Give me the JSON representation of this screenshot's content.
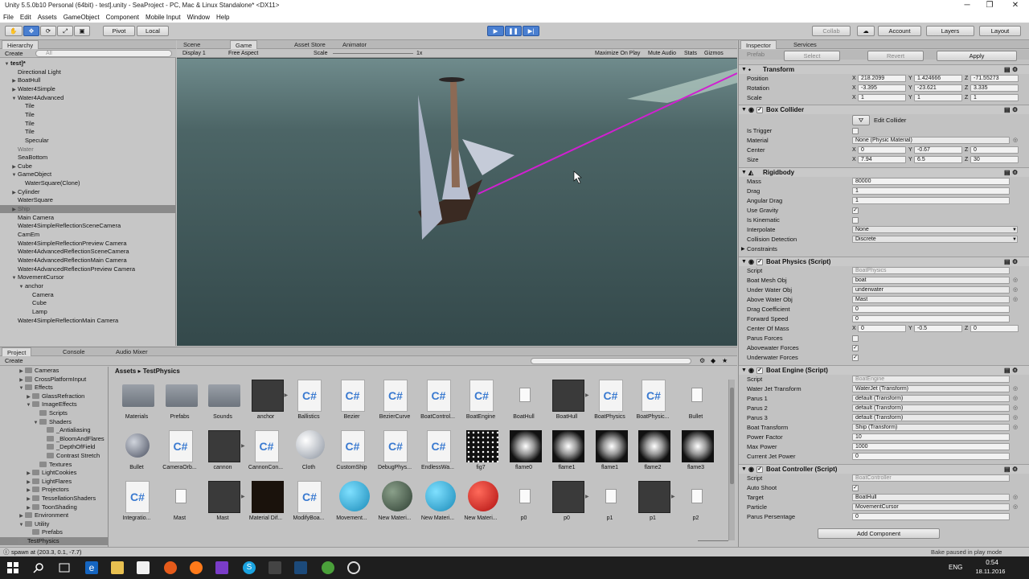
{
  "window": {
    "title": "Unity 5.5.0b10 Personal (64bit) - test].unity - SeaProject - PC, Mac & Linux Standalone* <DX11>",
    "minimize": "─",
    "maximize": "❐",
    "close": "✕"
  },
  "menu": [
    "File",
    "Edit",
    "Assets",
    "GameObject",
    "Component",
    "Mobile Input",
    "Window",
    "Help"
  ],
  "toolbar": {
    "pivot": "Pivot",
    "local": "Local",
    "collab": "Collab",
    "account": "Account",
    "layers": "Layers",
    "layout": "Layout"
  },
  "hierarchy": {
    "tab": "Hierarchy",
    "create": "Create",
    "search_placeholder": "All",
    "items": [
      {
        "label": "test]*",
        "tri": "▼",
        "bold": true
      },
      {
        "label": "Directional Light",
        "tri": ""
      },
      {
        "label": "BoatHull",
        "tri": "▶"
      },
      {
        "label": "Water4Simple",
        "tri": "▶"
      },
      {
        "label": "Water4Advanced",
        "tri": "▼"
      },
      {
        "label": "Tile",
        "tri": ""
      },
      {
        "label": "Tile",
        "tri": ""
      },
      {
        "label": "Tile",
        "tri": ""
      },
      {
        "label": "Tile",
        "tri": ""
      },
      {
        "label": "Specular",
        "tri": ""
      },
      {
        "label": "Water",
        "tri": "",
        "dim": true
      },
      {
        "label": "SeaBottom",
        "tri": ""
      },
      {
        "label": "Cube",
        "tri": "▶"
      },
      {
        "label": "GameObject",
        "tri": "▼"
      },
      {
        "label": "WaterSquare(Clone)",
        "tri": ""
      },
      {
        "label": "Cylinder",
        "tri": "▶"
      },
      {
        "label": "WaterSquare",
        "tri": ""
      },
      {
        "label": "Ship",
        "tri": "▶",
        "sel": true
      },
      {
        "label": "Main Camera",
        "tri": ""
      },
      {
        "label": "Water4SimpleReflectionSceneCamera",
        "tri": ""
      },
      {
        "label": "CamEm",
        "tri": ""
      },
      {
        "label": "Water4SimpleReflectionPreview Camera",
        "tri": ""
      },
      {
        "label": "Water4AdvancedReflectionSceneCamera",
        "tri": ""
      },
      {
        "label": "Water4AdvancedReflectionMain Camera",
        "tri": ""
      },
      {
        "label": "Water4AdvancedReflectionPreview Camera",
        "tri": ""
      },
      {
        "label": "MovementCursor",
        "tri": "▼"
      },
      {
        "label": "anchor",
        "tri": "▼"
      },
      {
        "label": "Camera",
        "tri": ""
      },
      {
        "label": "Cube",
        "tri": ""
      },
      {
        "label": "Lamp",
        "tri": ""
      },
      {
        "label": "Water4SimpleReflectionMain Camera",
        "tri": ""
      }
    ]
  },
  "view_tabs": {
    "scene": "Scene",
    "game": "Game",
    "asset_store": "Asset Store",
    "animator": "Animator"
  },
  "game_bar": {
    "display": "Display 1",
    "aspect": "Free Aspect",
    "scale_label": "Scale",
    "scale_value": "1x",
    "maximize": "Maximize On Play",
    "mute": "Mute Audio",
    "stats": "Stats",
    "gizmos": "Gizmos"
  },
  "inspector": {
    "tab": "Inspector",
    "tab2": "Services",
    "prefab": {
      "label": "Prefab",
      "select": "Select",
      "revert": "Revert",
      "apply": "Apply"
    },
    "transform": {
      "title": "Transform",
      "position": {
        "label": "Position",
        "x": "218.2099",
        "y": "1.424666",
        "z": "-71.55273"
      },
      "rotation": {
        "label": "Rotation",
        "x": "-3.395",
        "y": "-23.621",
        "z": "3.335"
      },
      "scale": {
        "label": "Scale",
        "x": "1",
        "y": "1",
        "z": "1"
      }
    },
    "box": {
      "title": "Box Collider",
      "edit": "Edit Collider",
      "trigger": "Is Trigger",
      "material_label": "Material",
      "material": "None (Physic Material)",
      "center": {
        "label": "Center",
        "x": "0",
        "y": "-0.67",
        "z": "0"
      },
      "size": {
        "label": "Size",
        "x": "7.94",
        "y": "6.5",
        "z": "30"
      }
    },
    "rb": {
      "title": "Rigidbody",
      "mass_label": "Mass",
      "mass": "80000",
      "drag_label": "Drag",
      "drag": "1",
      "adrag_label": "Angular Drag",
      "adrag": "1",
      "gravity": "Use Gravity",
      "kinematic": "Is Kinematic",
      "interp_label": "Interpolate",
      "interp": "None",
      "coll_label": "Collision Detection",
      "coll": "Discrete",
      "constraints": "Constraints"
    },
    "physics": {
      "title": "Boat Physics (Script)",
      "script_label": "Script",
      "script": "BoatPhysics",
      "mesh_label": "Boat Mesh Obj",
      "mesh": "boat",
      "under_label": "Under Water Obj",
      "under": "underwater",
      "above_label": "Above Water Obj",
      "above": "Mast",
      "dragc_label": "Drag Coefficient",
      "dragc": "0",
      "fspeed_label": "Forward Speed",
      "fspeed": "0",
      "com": {
        "label": "Center Of Mass",
        "x": "0",
        "y": "-0.5",
        "z": "0"
      },
      "parus": "Parus Forces",
      "abovef": "Abovewater Forces",
      "underf": "Underwater Forces"
    },
    "engine": {
      "title": "Boat Engine (Script)",
      "script_label": "Script",
      "script": "BoatEngine",
      "jet_label": "Water Jet Transform",
      "jet": "WaterJet (Transform)",
      "p1_label": "Parus 1",
      "p1": "default (Transform)",
      "p2_label": "Parus 2",
      "p2": "default (Transform)",
      "p3_label": "Parus 3",
      "p3": "default (Transform)",
      "bt_label": "Boat Transform",
      "bt": "Ship (Transform)",
      "pf_label": "Power Factor",
      "pf": "10",
      "mp_label": "Max Power",
      "mp": "1000",
      "cj_label": "Current Jet Power",
      "cj": "0"
    },
    "controller": {
      "title": "Boat Controller (Script)",
      "script_label": "Script",
      "script": "BoatController",
      "auto_label": "Auto Shoot",
      "target_label": "Target",
      "target": "BoatHull",
      "particle_label": "Particle",
      "particle": "MovementCursor",
      "pp_label": "Parus Persentage",
      "pp": "0"
    },
    "add": "Add Component"
  },
  "project": {
    "tab": "Project",
    "tab2": "Console",
    "tab3": "Audio Mixer",
    "create": "Create",
    "breadcrumb": [
      "Assets",
      "TestPhysics"
    ],
    "tree": [
      {
        "label": "Cameras",
        "d": 2,
        "tri": "▶"
      },
      {
        "label": "CrossPlatformInput",
        "d": 2,
        "tri": "▶"
      },
      {
        "label": "Effects",
        "d": 2,
        "tri": "▼"
      },
      {
        "label": "GlassRefraction",
        "d": 3,
        "tri": "▶"
      },
      {
        "label": "ImageEffects",
        "d": 3,
        "tri": "▼"
      },
      {
        "label": "Scripts",
        "d": 4,
        "tri": ""
      },
      {
        "label": "Shaders",
        "d": 4,
        "tri": "▼"
      },
      {
        "label": "_Antialiasing",
        "d": 5,
        "tri": ""
      },
      {
        "label": "_BloomAndFlares",
        "d": 5,
        "tri": ""
      },
      {
        "label": "_DepthOfField",
        "d": 5,
        "tri": ""
      },
      {
        "label": "Contrast Stretch",
        "d": 5,
        "tri": ""
      },
      {
        "label": "Textures",
        "d": 4,
        "tri": ""
      },
      {
        "label": "LightCookies",
        "d": 3,
        "tri": "▶"
      },
      {
        "label": "LightFlares",
        "d": 3,
        "tri": "▶"
      },
      {
        "label": "Projectors",
        "d": 3,
        "tri": "▶"
      },
      {
        "label": "TessellationShaders",
        "d": 3,
        "tri": "▶"
      },
      {
        "label": "ToonShading",
        "d": 3,
        "tri": "▶"
      },
      {
        "label": "Environment",
        "d": 2,
        "tri": "▶"
      },
      {
        "label": "Utility",
        "d": 2,
        "tri": "▼"
      },
      {
        "label": "Prefabs",
        "d": 3,
        "tri": ""
      },
      {
        "label": "TestPhysics",
        "d": 1,
        "tri": "",
        "sel": true
      }
    ],
    "assets": [
      {
        "label": "Materials",
        "k": "folder"
      },
      {
        "label": "Prefabs",
        "k": "folder"
      },
      {
        "label": "Sounds",
        "k": "folder"
      },
      {
        "label": "anchor",
        "k": "dark"
      },
      {
        "label": "Ballistics",
        "k": "cs"
      },
      {
        "label": "Bezier",
        "k": "cs"
      },
      {
        "label": "BezierCurve",
        "k": "cs"
      },
      {
        "label": "BoatControl...",
        "k": "cs"
      },
      {
        "label": "BoatEngine",
        "k": "cs"
      },
      {
        "label": "BoatHull",
        "k": "file"
      },
      {
        "label": "BoatHull",
        "k": "dark"
      },
      {
        "label": "BoatPhysics",
        "k": "cs"
      },
      {
        "label": "BoatPhysic...",
        "k": "cs"
      },
      {
        "label": "Bullet",
        "k": "file"
      },
      {
        "label": "Bullet",
        "k": "sphere"
      },
      {
        "label": "CameraOrb...",
        "k": "cs"
      },
      {
        "label": "cannon",
        "k": "dark"
      },
      {
        "label": "CannonCon...",
        "k": "cs"
      },
      {
        "label": "Cloth",
        "k": "cloth"
      },
      {
        "label": "CustomShip",
        "k": "cs"
      },
      {
        "label": "DebugPhys...",
        "k": "cs"
      },
      {
        "label": "EndlessWa...",
        "k": "cs"
      },
      {
        "label": "fig7",
        "k": "dots"
      },
      {
        "label": "flame0",
        "k": "flame"
      },
      {
        "label": "flame1",
        "k": "flame"
      },
      {
        "label": "flame1",
        "k": "flame"
      },
      {
        "label": "flame2",
        "k": "flame"
      },
      {
        "label": "flame3",
        "k": "flame"
      },
      {
        "label": "Integratio...",
        "k": "cs"
      },
      {
        "label": "Mast",
        "k": "file"
      },
      {
        "label": "Mast",
        "k": "dark"
      },
      {
        "label": "Material Dif...",
        "k": "matdark"
      },
      {
        "label": "ModifyBoa...",
        "k": "cs"
      },
      {
        "label": "Movement...",
        "k": "blue"
      },
      {
        "label": "New Materi...",
        "k": "green"
      },
      {
        "label": "New Materi...",
        "k": "blue"
      },
      {
        "label": "New Materi...",
        "k": "red"
      },
      {
        "label": "p0",
        "k": "file"
      },
      {
        "label": "p0",
        "k": "dark"
      },
      {
        "label": "p1",
        "k": "file"
      },
      {
        "label": "p1",
        "k": "dark"
      },
      {
        "label": "p2",
        "k": "file"
      }
    ]
  },
  "status": {
    "msg": "spawn at (203.3, 0.1, -7.7)",
    "bake": "Bake paused in play mode"
  },
  "taskbar": {
    "lang": "ENG",
    "time": "0:54",
    "date": "18.11.2016"
  },
  "colors": {
    "accent": "#4a7fd0",
    "laser": "#d020d0",
    "sea": "#3c4a4c"
  }
}
